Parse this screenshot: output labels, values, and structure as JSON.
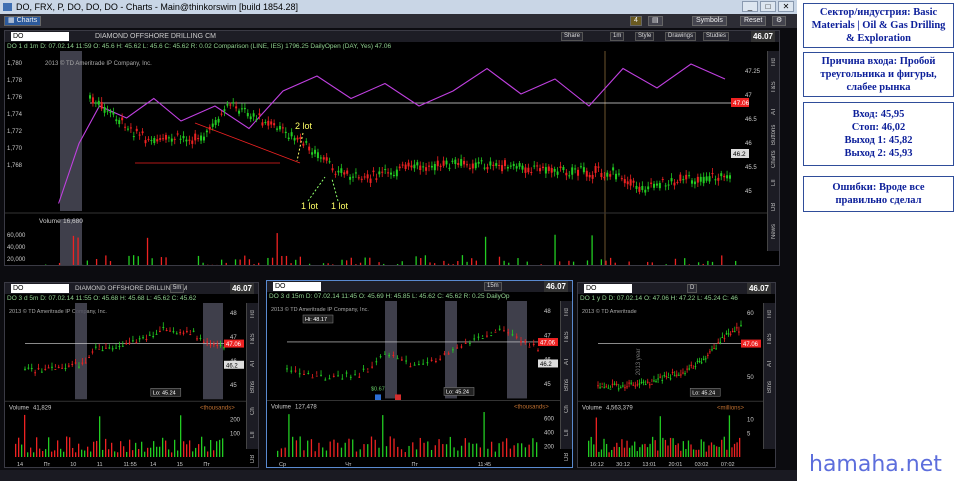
{
  "window": {
    "title": "DO, FRX, P, DO, DO, DO - Charts - Main@thinkorswim [build 1854.28]",
    "controls": [
      "_",
      "□",
      "✕"
    ]
  },
  "toolbar": {
    "tab": "Charts",
    "symbols_label": "Symbols",
    "reset_label": "Reset",
    "badge": "4"
  },
  "colors": {
    "up": "#22cc22",
    "down": "#ee2222",
    "comparison": "#c040e0",
    "bg": "#000000",
    "hl": "#4a4a58",
    "info": "#0c1f9a"
  },
  "main": {
    "symbol": "DO",
    "company": "DIAMOND OFFSHORE DRILLING CM",
    "price": "46.07",
    "stat": "DO 1 d 1m  D: 07.02.14 11:59  O: 45.6  H: 45.62  L: 45.6  C: 45.62  R: 0.02  Comparison (LINE, IES) 1796.25  DailyOpen (DAY, Yes) 47.06",
    "copyright": "2013 © TD Ameritrade IP Company, Inc.",
    "share": "Share",
    "interval": "1m",
    "style": "Style",
    "drawings": "Drawings",
    "studies": "Studies",
    "left_ticks": [
      "1,780",
      "1,778",
      "1,776",
      "1,774",
      "1,772",
      "1,770",
      "1,768"
    ],
    "right_tags": [
      "47.06",
      "46.2"
    ],
    "right_ticks": [
      "47.25",
      "47",
      "46.5",
      "46",
      "45.5",
      "45"
    ],
    "volume_label": "Volume",
    "volume_value": "16,680",
    "vol_ticks": [
      "60,000",
      "40,000",
      "20,000"
    ],
    "x_ticks": [
      "Пт",
      "9:31",
      "9:45",
      "10:00",
      "10:15",
      "10:30",
      "10:45",
      "11:00",
      "11:15",
      "11:30",
      "11:45",
      "12:00",
      "12:15",
      "12:30"
    ],
    "cursor_time": "11:59",
    "annotations": [
      "2 lot",
      "1 lot",
      "1 lot"
    ],
    "side_tabs": [
      "Trd",
      "T&S",
      "AT",
      "Buttons",
      "Charts",
      "LII",
      "DB",
      "News"
    ]
  },
  "panes": [
    {
      "symbol": "DO",
      "company": "DIAMOND OFFSHORE DRILLING CM",
      "price": "46.07",
      "stat": "DO 3 d 5m  D: 07.02.14 11:55  O: 45.68  H: 45.68  L: 45.62  C: 45.62",
      "interval": "5m",
      "copyright": "2013 © TD Ameritrade IP Company, Inc.",
      "tags": [
        "47.06",
        "46.2"
      ],
      "low_label": "Lo: 45.24",
      "volume_label": "Volume",
      "volume_value": "41,829",
      "unit": "<thousands>",
      "x_ticks": [
        "14",
        "Пт",
        "10",
        "11",
        "11:55",
        "14",
        "15",
        "Пт"
      ],
      "cursor_time": "11:55",
      "y_ticks": [
        "48",
        "47",
        "46",
        "45"
      ],
      "v_ticks": [
        "200",
        "100"
      ],
      "side_tabs": [
        "Trd",
        "T&S",
        "AT",
        "Btns",
        "Ch",
        "LII",
        "DB",
        "N"
      ]
    },
    {
      "symbol": "DO",
      "company": "",
      "price": "46.07",
      "stat": "DO 3 d 15m  D: 07.02.14 11:45  O: 45.69  H: 45.85  L: 45.62  C: 45.62  R: 0.25  DailyOp",
      "interval": "15m",
      "copyright": "2013 © TD Ameritrade IP Company, Inc.",
      "tags": [
        "47.06",
        "46.2"
      ],
      "high_label": "Hi: 48.17",
      "low_label": "Lo: 45.24",
      "price_label": "$0.67",
      "volume_label": "Volume",
      "volume_value": "127,478",
      "unit": "<thousands>",
      "x_ticks": [
        "Ср",
        "Чт",
        "Пт",
        "11:45"
      ],
      "cursor_time": "11:45",
      "y_ticks": [
        "48",
        "47",
        "46",
        "45"
      ],
      "v_ticks": [
        "600",
        "400",
        "200"
      ],
      "side_tabs": [
        "Trd",
        "T&S",
        "AT",
        "Btns",
        "Ch",
        "LII",
        "DB",
        "N"
      ]
    },
    {
      "symbol": "DO",
      "company": "",
      "price": "46.07",
      "stat": "DO 1 y D  D: 07.02.14  O: 47.06  H: 47.22  L: 45.24  C: 46",
      "interval": "D",
      "copyright": "2013 © TD Ameritrade",
      "tags": [
        "47.06"
      ],
      "year_label": "2013 year",
      "low_label": "Lo: 45.24",
      "volume_label": "Volume",
      "volume_value": "4,563,379",
      "unit": "<millions>",
      "x_ticks": [
        "16:12",
        "30:12",
        "13:01",
        "20:01",
        "03:02",
        "07:02"
      ],
      "cursor_time": "07:02",
      "y_ticks": [
        "60",
        "55",
        "50"
      ],
      "v_ticks": [
        "10",
        "5"
      ],
      "side_tabs": [
        "Trd",
        "T&S",
        "AT",
        "Btns"
      ]
    }
  ],
  "sidebar": {
    "sector": "Сектор/индустрия: Basic Materials | Oil & Gas Drilling & Exploration",
    "reason": "Причина входа: Пробой треугольника и фигуры, слабее рынка",
    "entry": "Вход: 45,95",
    "stop": "Стоп: 46,02",
    "exit1": "Выход 1: 45,82",
    "exit2": "Выход 2: 45,93",
    "mistakes": "Ошибки: Вроде все правильно сделал",
    "brand": "hamaha.net"
  }
}
